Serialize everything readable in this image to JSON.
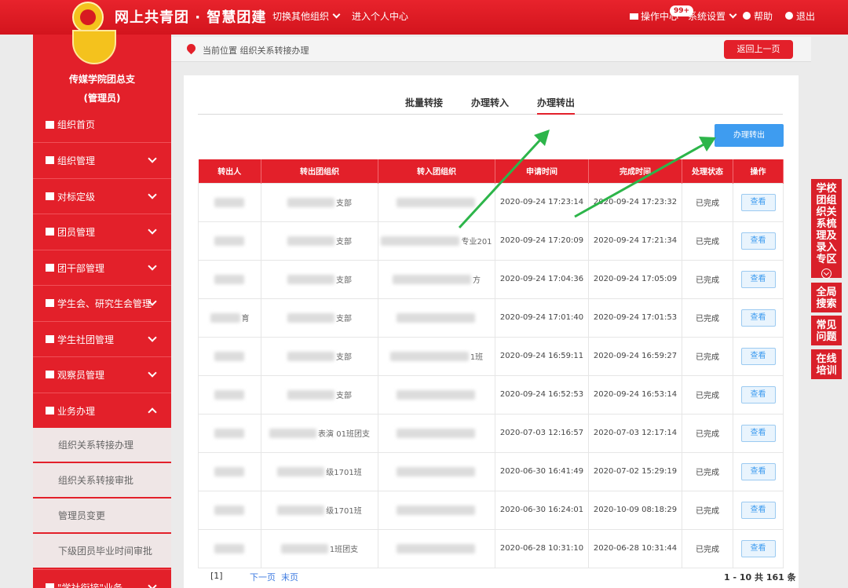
{
  "header": {
    "brand": "网上共青团 · 智慧团建",
    "switch_org": "切换其他组织",
    "personal_center": "进入个人中心",
    "ops_center": "操作中心",
    "badge": "99+",
    "system_settings": "系统设置",
    "help": "帮助",
    "logout": "退出",
    "colors": {
      "primary": "#e3202a",
      "accent_blue": "#3e9cf0",
      "annotation": "#2db54a"
    }
  },
  "sidebar": {
    "org_name": "传媒学院团总支",
    "role": "(管理员)",
    "home": "组织首页",
    "items": [
      {
        "label": "组织管理",
        "icon": "tree-icon"
      },
      {
        "label": "对标定级",
        "icon": "tree-icon"
      },
      {
        "label": "团员管理",
        "icon": "users-icon"
      },
      {
        "label": "团干部管理",
        "icon": "users-icon"
      },
      {
        "label": "学生会、研究生会管理",
        "icon": "users-icon"
      },
      {
        "label": "学生社团管理",
        "icon": "users-icon"
      },
      {
        "label": "观察员管理",
        "icon": "users-icon"
      },
      {
        "label": "业务办理",
        "icon": "list-icon"
      }
    ],
    "sub_items": [
      "组织关系转接办理",
      "组织关系转接审批",
      "管理员变更",
      "下级团员毕业时间审批"
    ],
    "bottom_item": "\"学社衔接\"业务"
  },
  "breadcrumb": {
    "text": "当前位置 组织关系转接办理",
    "back": "返回上一页"
  },
  "right_tabs": [
    "学校团组织关系梳理及录入专区",
    "全局搜索",
    "常见问题",
    "在线培训"
  ],
  "tabs": {
    "batch": "批量转接",
    "transfer_in": "办理转入",
    "transfer_out": "办理转出"
  },
  "action_button": "办理转出",
  "table": {
    "headers": [
      "转出人",
      "转出团组织",
      "转入团组织",
      "申请时间",
      "完成时间",
      "处理状态",
      "操作"
    ],
    "rows": [
      {
        "from": "",
        "out_org": "支部",
        "in_org": "",
        "apply": "2020-09-24 17:23:14",
        "done": "2020-09-24 17:23:32",
        "status": "已完成",
        "op": "查看"
      },
      {
        "from": "",
        "out_org": "支部",
        "in_org": "专业201",
        "apply": "2020-09-24 17:20:09",
        "done": "2020-09-24 17:21:34",
        "status": "已完成",
        "op": "查看"
      },
      {
        "from": "",
        "out_org": "支部",
        "in_org": "方",
        "apply": "2020-09-24 17:04:36",
        "done": "2020-09-24 17:05:09",
        "status": "已完成",
        "op": "查看"
      },
      {
        "from": "育",
        "out_org": "支部",
        "in_org": "",
        "apply": "2020-09-24 17:01:40",
        "done": "2020-09-24 17:01:53",
        "status": "已完成",
        "op": "查看"
      },
      {
        "from": "",
        "out_org": "支部",
        "in_org": "1班",
        "apply": "2020-09-24 16:59:11",
        "done": "2020-09-24 16:59:27",
        "status": "已完成",
        "op": "查看"
      },
      {
        "from": "",
        "out_org": "支部",
        "in_org": "",
        "apply": "2020-09-24 16:52:53",
        "done": "2020-09-24 16:53:14",
        "status": "已完成",
        "op": "查看"
      },
      {
        "from": "",
        "out_org": "表演 01班团支",
        "in_org": "",
        "apply": "2020-07-03 12:16:57",
        "done": "2020-07-03 12:17:14",
        "status": "已完成",
        "op": "查看"
      },
      {
        "from": "",
        "out_org": "级1701班",
        "in_org": "",
        "apply": "2020-06-30 16:41:49",
        "done": "2020-07-02 15:29:19",
        "status": "已完成",
        "op": "查看"
      },
      {
        "from": "",
        "out_org": "级1701班",
        "in_org": "",
        "apply": "2020-06-30 16:24:01",
        "done": "2020-10-09 08:18:29",
        "status": "已完成",
        "op": "查看"
      },
      {
        "from": "",
        "out_org": "1班团支",
        "in_org": "",
        "apply": "2020-06-28 10:31:10",
        "done": "2020-06-28 10:31:44",
        "status": "已完成",
        "op": "查看"
      }
    ]
  },
  "pagination": {
    "current": "[1]",
    "next": "下一页",
    "last": "末页",
    "summary": "1 - 10 共 161 条"
  }
}
